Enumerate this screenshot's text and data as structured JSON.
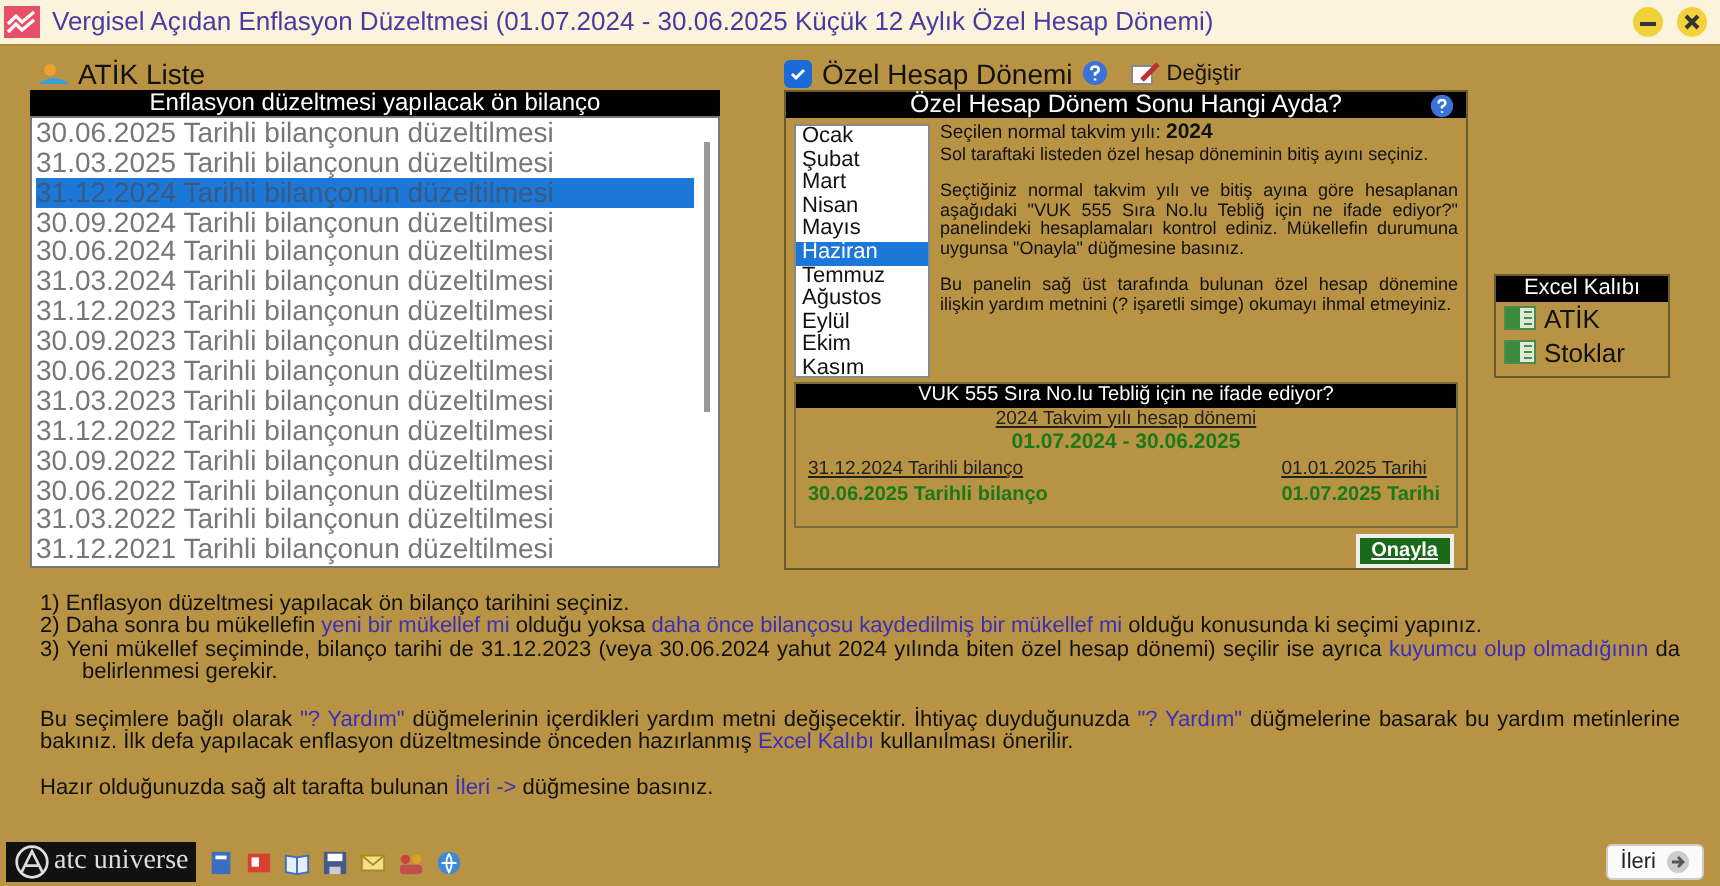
{
  "window": {
    "title": "Vergisel Açıdan Enflasyon Düzeltmesi (01.07.2024 - 30.06.2025 Küçük 12 Aylık Özel Hesap Dönemi)"
  },
  "atik_list": {
    "title": "ATİK Liste",
    "header": "Enflasyon düzeltmesi yapılacak ön bilanço",
    "items": [
      {
        "label": "30.06.2025 Tarihli bilançonun düzeltilmesi",
        "selected": false
      },
      {
        "label": "31.03.2025 Tarihli bilançonun düzeltilmesi",
        "selected": false
      },
      {
        "label": "31.12.2024 Tarihli bilançonun düzeltilmesi",
        "selected": true
      },
      {
        "label": "30.09.2024 Tarihli bilançonun düzeltilmesi",
        "selected": false
      },
      {
        "label": "30.06.2024 Tarihli bilançonun düzeltilmesi",
        "selected": false
      },
      {
        "label": "31.03.2024 Tarihli bilançonun düzeltilmesi",
        "selected": false
      },
      {
        "label": "31.12.2023 Tarihli bilançonun düzeltilmesi",
        "selected": false
      },
      {
        "label": "30.09.2023 Tarihli bilançonun düzeltilmesi",
        "selected": false
      },
      {
        "label": "30.06.2023 Tarihli bilançonun düzeltilmesi",
        "selected": false
      },
      {
        "label": "31.03.2023 Tarihli bilançonun düzeltilmesi",
        "selected": false
      },
      {
        "label": "31.12.2022 Tarihli bilançonun düzeltilmesi",
        "selected": false
      },
      {
        "label": "30.09.2022 Tarihli bilançonun düzeltilmesi",
        "selected": false
      },
      {
        "label": "30.06.2022 Tarihli bilançonun düzeltilmesi",
        "selected": false
      },
      {
        "label": "31.03.2022 Tarihli bilançonun düzeltilmesi",
        "selected": false
      },
      {
        "label": "31.12.2021 Tarihli bilançonun düzeltilmesi",
        "selected": false
      }
    ]
  },
  "special_period": {
    "label": "Özel Hesap Dönemi",
    "checked": true,
    "change_button": "Değiştir",
    "header": "Özel Hesap Dönem Sonu Hangi Ayda?",
    "months": [
      {
        "label": "Ocak",
        "selected": false
      },
      {
        "label": "Şubat",
        "selected": false
      },
      {
        "label": "Mart",
        "selected": false
      },
      {
        "label": "Nisan",
        "selected": false
      },
      {
        "label": "Mayıs",
        "selected": false
      },
      {
        "label": "Haziran",
        "selected": true
      },
      {
        "label": "Temmuz",
        "selected": false
      },
      {
        "label": "Ağustos",
        "selected": false
      },
      {
        "label": "Eylül",
        "selected": false
      },
      {
        "label": "Ekim",
        "selected": false
      },
      {
        "label": "Kasım",
        "selected": false
      }
    ],
    "year_label": "Seçilen normal takvim yılı:",
    "year": "2024",
    "paragraphs": [
      "Sol taraftaki listeden özel hesap döneminin bitiş ayını seçiniz.",
      "Seçtiğiniz normal takvim yılı ve bitiş ayına göre hesaplanan aşağıdaki \"VUK 555 Sıra No.lu Tebliğ için ne ifade ediyor?\" panelindeki hesaplamaları kontrol ediniz. Mükellefin durumuna uygunsa \"Onayla\" düğmesine basınız.",
      "Bu panelin sağ üst tarafında bulunan özel hesap dönemine ilişkin yardım metnini (? işaretli simge) okumayı ihmal etmeyiniz."
    ],
    "vuk_header": "VUK 555 Sıra No.lu Tebliğ için ne ifade ediyor?",
    "period_label": "2024 Takvim yılı hesap dönemi",
    "period_value": "01.07.2024 - 30.06.2025",
    "balance_label": "31.12.2024 Tarihli bilanço",
    "balance_value": "30.06.2025 Tarihli bilanço",
    "date_label": "01.01.2025 Tarihi",
    "date_value": "01.07.2025 Tarihi",
    "confirm_button": "Onayla"
  },
  "excel_template": {
    "title": "Excel Kalıbı",
    "items": [
      "ATİK",
      "Stoklar"
    ]
  },
  "instructions": [
    [
      {
        "text": "1) Enflasyon düzeltmesi yapılacak ön bilanço tarihini seçiniz.",
        "link": false
      }
    ],
    [
      {
        "text": "2) Daha sonra bu mükellefin ",
        "link": false
      },
      {
        "text": "yeni bir mükellef mi",
        "link": true
      },
      {
        "text": " olduğu yoksa ",
        "link": false
      },
      {
        "text": "daha önce bilançosu kaydedilmiş bir mükellef mi",
        "link": true
      },
      {
        "text": " olduğu konusunda ki seçimi yapınız.",
        "link": false
      }
    ],
    [
      {
        "text": "3) Yeni mükellef seçiminde, bilanço tarihi de 31.12.2023 (veya 30.06.2024 yahut 2024 yılında biten özel hesap dönemi) seçilir ise ayrıca ",
        "link": false
      },
      {
        "text": "kuyumcu olup olmadığının",
        "link": true
      },
      {
        "text": " da belirlenmesi gerekir.",
        "link": false
      }
    ]
  ],
  "notes": [
    [
      {
        "text": "Bu seçimlere bağlı olarak  ",
        "link": false
      },
      {
        "text": "\"? Yardım\"",
        "link": true
      },
      {
        "text": " düğmelerinin içerdikleri yardım metni değişecektir. İhtiyaç duyduğunuzda  ",
        "link": false
      },
      {
        "text": "\"? Yardım\"",
        "link": true
      },
      {
        "text": " düğmelerine basarak bu yardım metinlerine bakınız. İlk defa yapılacak enflasyon düzeltmesinde önceden hazırlanmış ",
        "link": false
      },
      {
        "text": "Excel Kalıbı",
        "link": true
      },
      {
        "text": " kullanılması önerilir.",
        "link": false
      }
    ],
    [
      {
        "text": "Hazır olduğunuzda sağ alt tarafta bulunan ",
        "link": false
      },
      {
        "text": "İleri ->",
        "link": true
      },
      {
        "text": " düğmesine basınız.",
        "link": false
      }
    ]
  ],
  "footer": {
    "logo": "atc universe",
    "next_button": "İleri"
  }
}
